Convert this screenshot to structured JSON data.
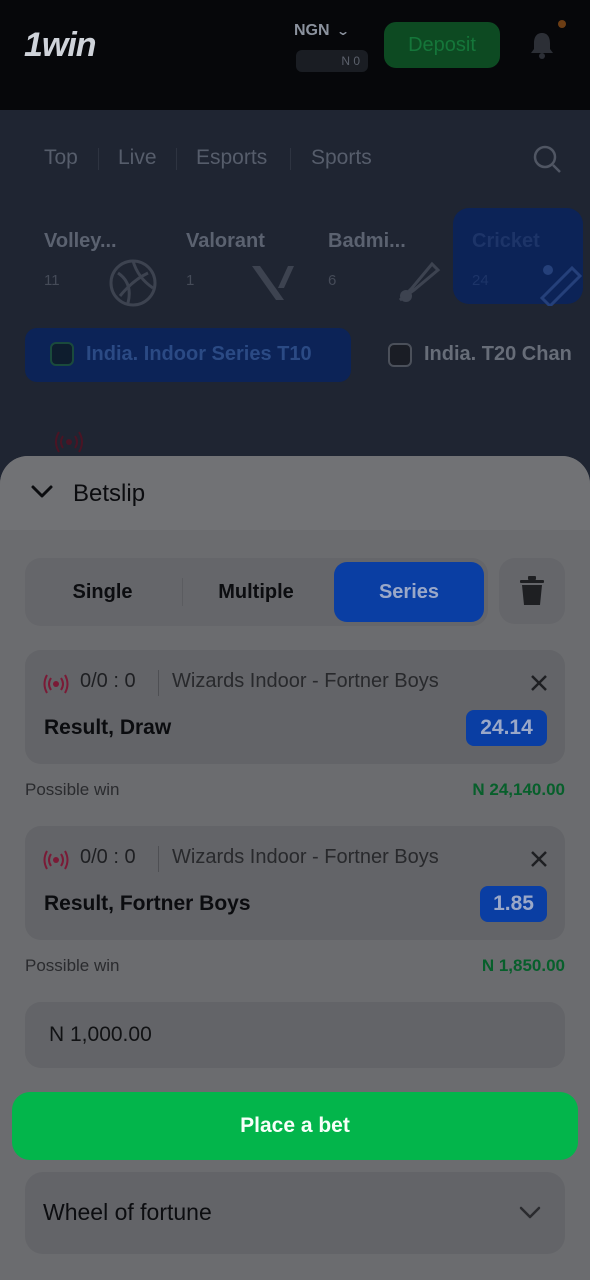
{
  "header": {
    "logo": "1win",
    "currency": "NGN",
    "balance": "N 0",
    "deposit_label": "Deposit"
  },
  "nav": {
    "tabs": [
      "Top",
      "Live",
      "Esports",
      "Sports"
    ]
  },
  "sports": [
    {
      "name": "Volley...",
      "count": "11",
      "icon": "volleyball-icon"
    },
    {
      "name": "Valorant",
      "count": "1",
      "icon": "valorant-icon"
    },
    {
      "name": "Badmi...",
      "count": "6",
      "icon": "shuttlecock-icon"
    },
    {
      "name": "Cricket",
      "count": "24",
      "icon": "cricket-icon"
    }
  ],
  "leagues": [
    {
      "name": "India. Indoor Series T10",
      "active": true
    },
    {
      "name": "India. T20 Chan",
      "active": false
    }
  ],
  "betslip": {
    "title": "Betslip",
    "types": [
      "Single",
      "Multiple",
      "Series"
    ],
    "active_type": "Series",
    "bets": [
      {
        "score": "0/0 : 0",
        "match": "Wizards Indoor - Fortner Boys",
        "selection": "Result, Draw",
        "odds": "24.14",
        "possible_win_label": "Possible win",
        "possible_win": "N 24,140.00"
      },
      {
        "score": "0/0 : 0",
        "match": "Wizards Indoor - Fortner Boys",
        "selection": "Result, Fortner Boys",
        "odds": "1.85",
        "possible_win_label": "Possible win",
        "possible_win": "N 1,850.00"
      }
    ],
    "stake_value": "N 1,000.00",
    "place_bet_label": "Place a bet",
    "wheel_label": "Wheel of fortune"
  },
  "colors": {
    "accent_blue": "#0a3ea3",
    "place_bet_green": "#03b54b",
    "win_green": "#075f2b",
    "live_red": "#7a1a36"
  }
}
